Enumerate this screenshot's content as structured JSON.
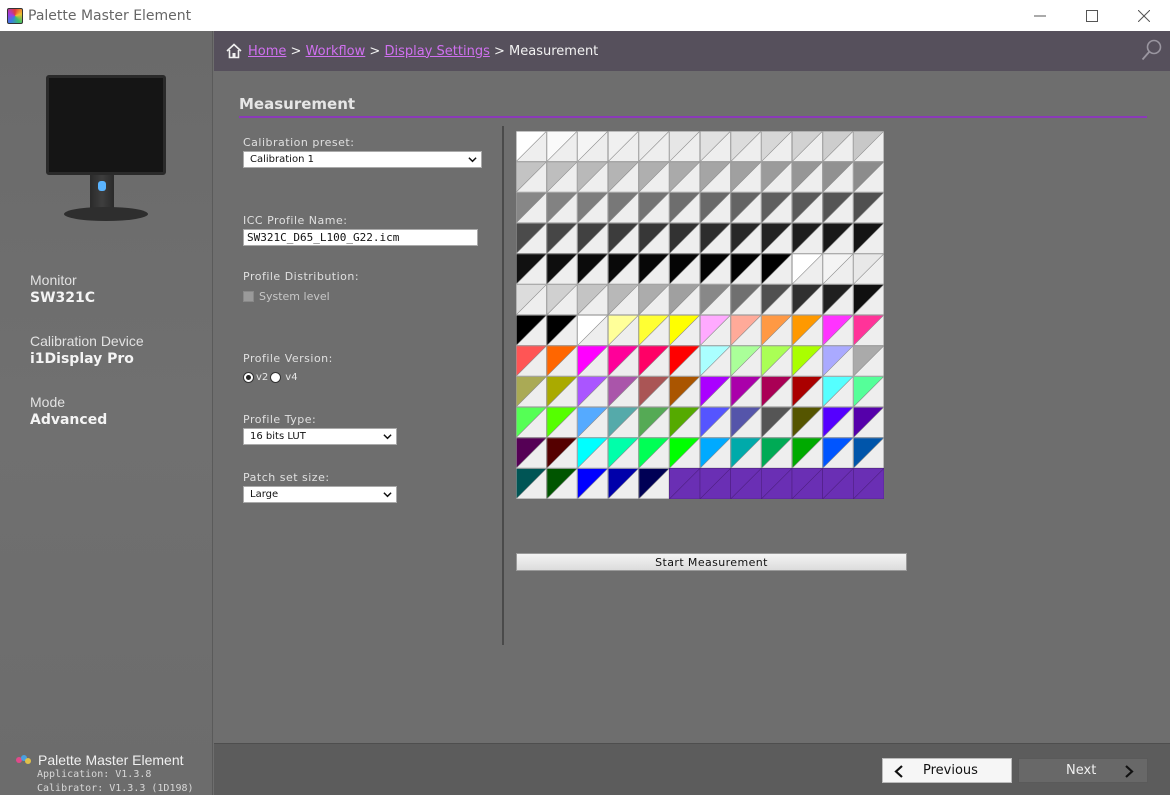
{
  "window": {
    "title": "Palette Master Element",
    "controls": [
      "minimize-icon",
      "maximize-icon",
      "close-icon"
    ]
  },
  "sidebar": {
    "monitor_label": "Monitor",
    "monitor_value": "SW321C",
    "device_label": "Calibration Device",
    "device_value": "i1Display Pro",
    "mode_label": "Mode",
    "mode_value": "Advanced",
    "brand_name": "Palette Master Element",
    "app_version": "Application: V1.3.8",
    "calibrator_version": "Calibrator: V1.3.3 (1D198)"
  },
  "breadcrumb": {
    "home": "Home",
    "workflow": "Workflow",
    "display_settings": "Display Settings",
    "current": "Measurement",
    "separator": ">"
  },
  "main": {
    "title": "Measurement",
    "calibration_preset_label": "Calibration preset:",
    "calibration_preset_value": "Calibration 1",
    "icc_label": "ICC Profile Name:",
    "icc_value": "SW321C_D65_L100_G22.icm",
    "distribution_label": "Profile Distribution:",
    "system_level_label": "System level",
    "system_level_checked": false,
    "version_label": "Profile Version:",
    "version_v2": "v2",
    "version_v4": "v4",
    "version_selected": "v2",
    "type_label": "Profile Type:",
    "type_value": "16 bits LUT",
    "patch_label": "Patch set size:",
    "patch_value": "Large",
    "start_button": "Start Measurement"
  },
  "patches": {
    "rows": 12,
    "cols": 12,
    "cells": [
      [
        "#ffffff",
        "#fafafa",
        "#f5f5f5",
        "#f0f0f0",
        "#ebebeb",
        "#e6e6e6",
        "#e1e1e1",
        "#dcdcdc",
        "#d7d7d7",
        "#d2d2d2",
        "#cdcdcd",
        "#c8c8c8"
      ],
      [
        "#c3c3c3",
        "#bebebe",
        "#b9b9b9",
        "#b4b4b4",
        "#afafaf",
        "#aaaaaa",
        "#a5a5a5",
        "#a0a0a0",
        "#9b9b9b",
        "#969696",
        "#919191",
        "#8c8c8c"
      ],
      [
        "#878787",
        "#828282",
        "#7d7d7d",
        "#787878",
        "#737373",
        "#6e6e6e",
        "#696969",
        "#646464",
        "#5f5f5f",
        "#5a5a5a",
        "#555555",
        "#505050"
      ],
      [
        "#4b4b4b",
        "#464646",
        "#414141",
        "#3c3c3c",
        "#373737",
        "#323232",
        "#2d2d2d",
        "#282828",
        "#232323",
        "#1e1e1e",
        "#191919",
        "#141414"
      ],
      [
        "#111111",
        "#0e0e0e",
        "#0b0b0b",
        "#090909",
        "#070707",
        "#050505",
        "#030303",
        "#020202",
        "#000000",
        "#ffffff",
        "#f4f4f4",
        "#e8e8e8"
      ],
      [
        "#dcdcdc",
        "#d0d0d0",
        "#c4c4c4",
        "#b8b8b8",
        "#acacac",
        "#a0a0a0",
        "#888888",
        "#707070",
        "#505050",
        "#303030",
        "#202020",
        "#101010"
      ],
      [
        "#000000",
        "#000000",
        "#ffffff",
        "#ffff99",
        "#ffff33",
        "#ffff00",
        "#ffaaff",
        "#ffaa99",
        "#ff9944",
        "#ff9900",
        "#ff33ff",
        "#ff3399"
      ],
      [
        "#ff5555",
        "#ff6600",
        "#ff00ff",
        "#ff0099",
        "#ff0066",
        "#ff0000",
        "#aaffff",
        "#aaff99",
        "#aaff55",
        "#aaff00",
        "#aaaaff",
        "#aaaaaa"
      ],
      [
        "#aaaa55",
        "#aaaa00",
        "#aa55ff",
        "#aa55aa",
        "#aa5555",
        "#aa5500",
        "#aa00ff",
        "#aa00aa",
        "#aa0055",
        "#aa0000",
        "#55ffff",
        "#55ff99"
      ],
      [
        "#55ff55",
        "#55ff00",
        "#55aaff",
        "#55aaaa",
        "#55aa55",
        "#55aa00",
        "#5555ff",
        "#5555aa",
        "#555555",
        "#555500",
        "#5500ff",
        "#5500aa"
      ],
      [
        "#550055",
        "#550000",
        "#00ffff",
        "#00ffaa",
        "#00ff55",
        "#00ff00",
        "#00aaff",
        "#00aaaa",
        "#00aa55",
        "#00aa00",
        "#0055ff",
        "#0055aa"
      ],
      [
        "#005555",
        "#005500",
        "#0000ff",
        "#0000aa",
        "#000055",
        "#6a2fb4",
        "#6a2fb4",
        "#6a2fb4",
        "#6a2fb4",
        "#6a2fb4",
        "#6a2fb4",
        "#6a2fb4"
      ]
    ],
    "fill_color": "#6a2fb4",
    "filled_from_index": 137
  },
  "footer": {
    "previous": "Previous",
    "next": "Next"
  },
  "colors": {
    "accent": "#8a3ab8",
    "link": "#d070f0",
    "header_bg": "#56505c"
  }
}
